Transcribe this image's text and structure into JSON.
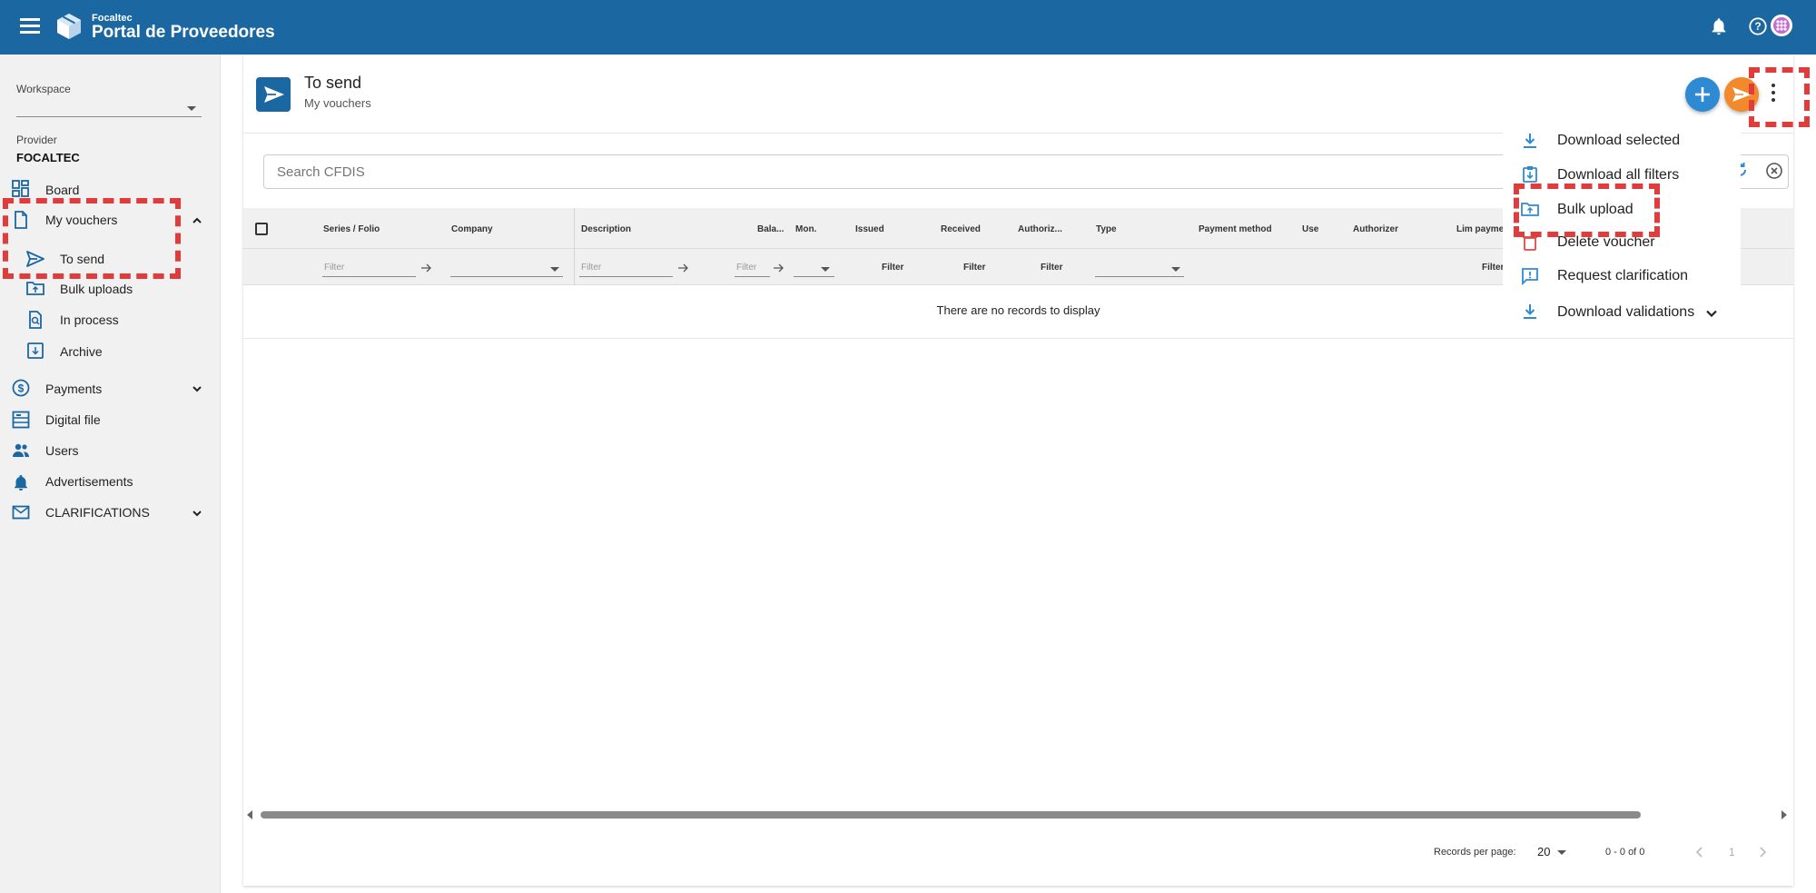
{
  "header": {
    "brand_small": "Focaltec",
    "brand_name": "Portal de Proveedores",
    "colors": {
      "primary": "#1b67a2",
      "accent": "#f28a2d",
      "highlight": "#e03c3c"
    }
  },
  "sidebar": {
    "workspace_label": "Workspace",
    "workspace_value": "",
    "provider_label": "Provider",
    "provider_value": "FOCALTEC",
    "items": [
      {
        "label": "Board",
        "icon": "dashboard-icon"
      },
      {
        "label": "My vouchers",
        "icon": "document-icon",
        "expanded": true
      },
      {
        "label": "To send",
        "icon": "send-icon",
        "selected": true
      },
      {
        "label": "Bulk uploads",
        "icon": "folder-upload-icon"
      },
      {
        "label": "In process",
        "icon": "document-search-icon"
      },
      {
        "label": "Archive",
        "icon": "archive-icon"
      },
      {
        "label": "Payments",
        "icon": "dollar-icon"
      },
      {
        "label": "Digital file",
        "icon": "digital-file-icon"
      },
      {
        "label": "Users",
        "icon": "users-icon"
      },
      {
        "label": "Advertisements",
        "icon": "bell-icon"
      },
      {
        "label": "CLARIFICATIONS",
        "icon": "mail-icon"
      }
    ]
  },
  "page": {
    "title": "To send",
    "subtitle": "My vouchers"
  },
  "search": {
    "placeholder": "Search CFDIS"
  },
  "table": {
    "columns": [
      "Series / Folio",
      "Company",
      "Description",
      "Bala...",
      "Mon.",
      "Issued",
      "Received",
      "Authoriz...",
      "Type",
      "Payment method",
      "Use",
      "Authorizer",
      "Lim paymen"
    ],
    "filter_placeholder": "Filter",
    "filter_button": "Filter",
    "empty_message": "There are no records to display"
  },
  "pagination": {
    "records_per_page_label": "Records per page:",
    "records_per_page": "20",
    "range": "0 - 0 of 0",
    "page": "1"
  },
  "menu": {
    "items": [
      {
        "label": "Download selected",
        "icon": "download-icon"
      },
      {
        "label": "Download all filters",
        "icon": "download-filter-icon"
      },
      {
        "label": "Bulk upload",
        "icon": "folder-upload-icon"
      },
      {
        "label": "Delete voucher",
        "icon": "trash-icon"
      },
      {
        "label": "Request clarification",
        "icon": "chat-alert-icon"
      },
      {
        "label": "Download validations",
        "icon": "download-icon"
      }
    ]
  }
}
